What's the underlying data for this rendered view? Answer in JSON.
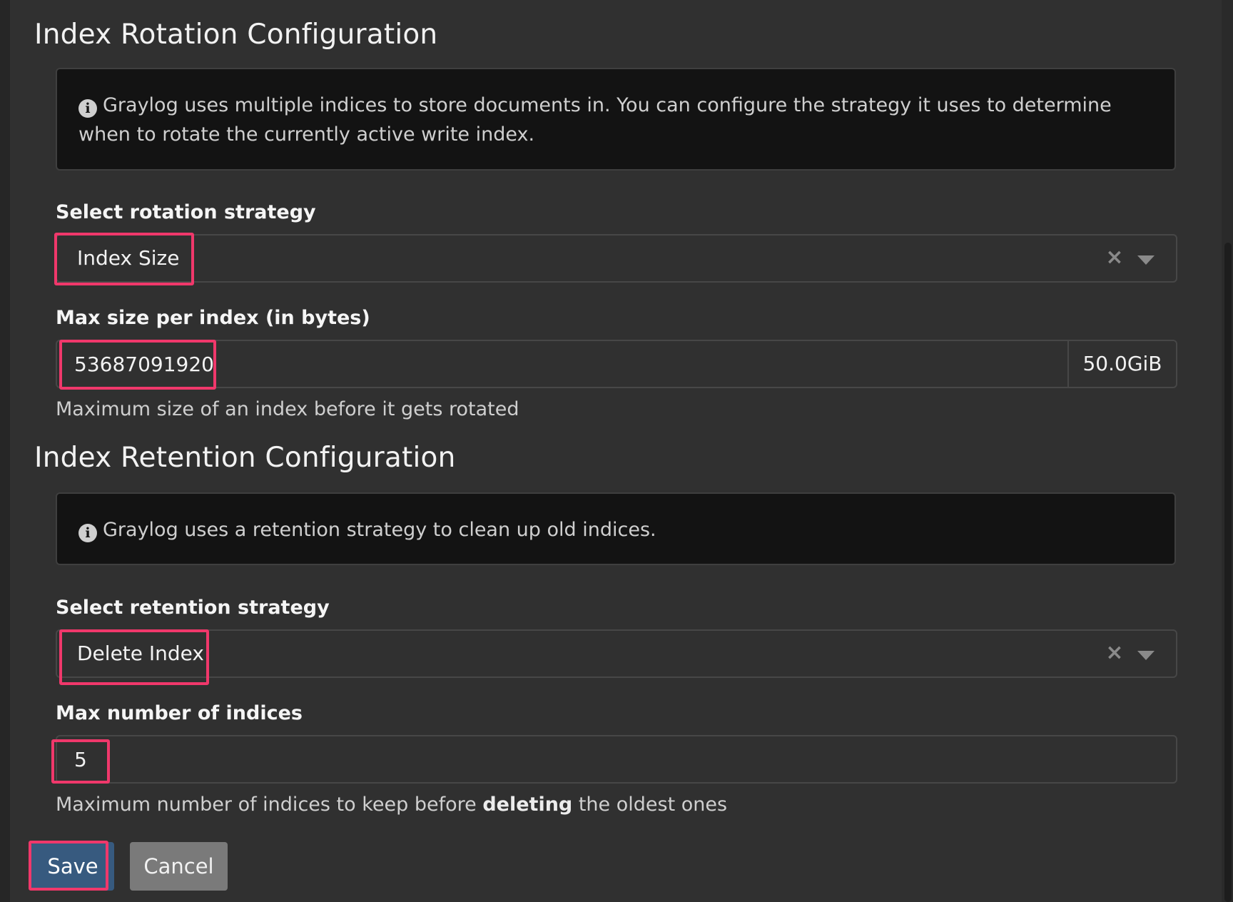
{
  "rotation": {
    "title": "Index Rotation Configuration",
    "info": "Graylog uses multiple indices to store documents in. You can configure the strategy it uses to determine when to rotate the currently active write index.",
    "strategy_label": "Select rotation strategy",
    "strategy_value": "Index Size",
    "max_size_label": "Max size per index (in bytes)",
    "max_size_value": "53687091920",
    "max_size_unit": "50.0GiB",
    "max_size_help": "Maximum size of an index before it gets rotated"
  },
  "retention": {
    "title": "Index Retention Configuration",
    "info": "Graylog uses a retention strategy to clean up old indices.",
    "strategy_label": "Select retention strategy",
    "strategy_value": "Delete Index",
    "max_indices_label": "Max number of indices",
    "max_indices_value": "5",
    "help_before": "Maximum number of indices to keep before ",
    "help_bold": "deleting",
    "help_after": " the oldest ones"
  },
  "actions": {
    "save_label": "Save",
    "cancel_label": "Cancel"
  },
  "icons": {
    "info": "info-circle-icon",
    "clear": "clear-x-icon",
    "caret": "caret-down-icon"
  },
  "colors": {
    "background": "#303030",
    "info_box": "#131313",
    "highlight": "#f0386b",
    "save_button": "#375a7f",
    "cancel_button": "#7a7a7a"
  }
}
